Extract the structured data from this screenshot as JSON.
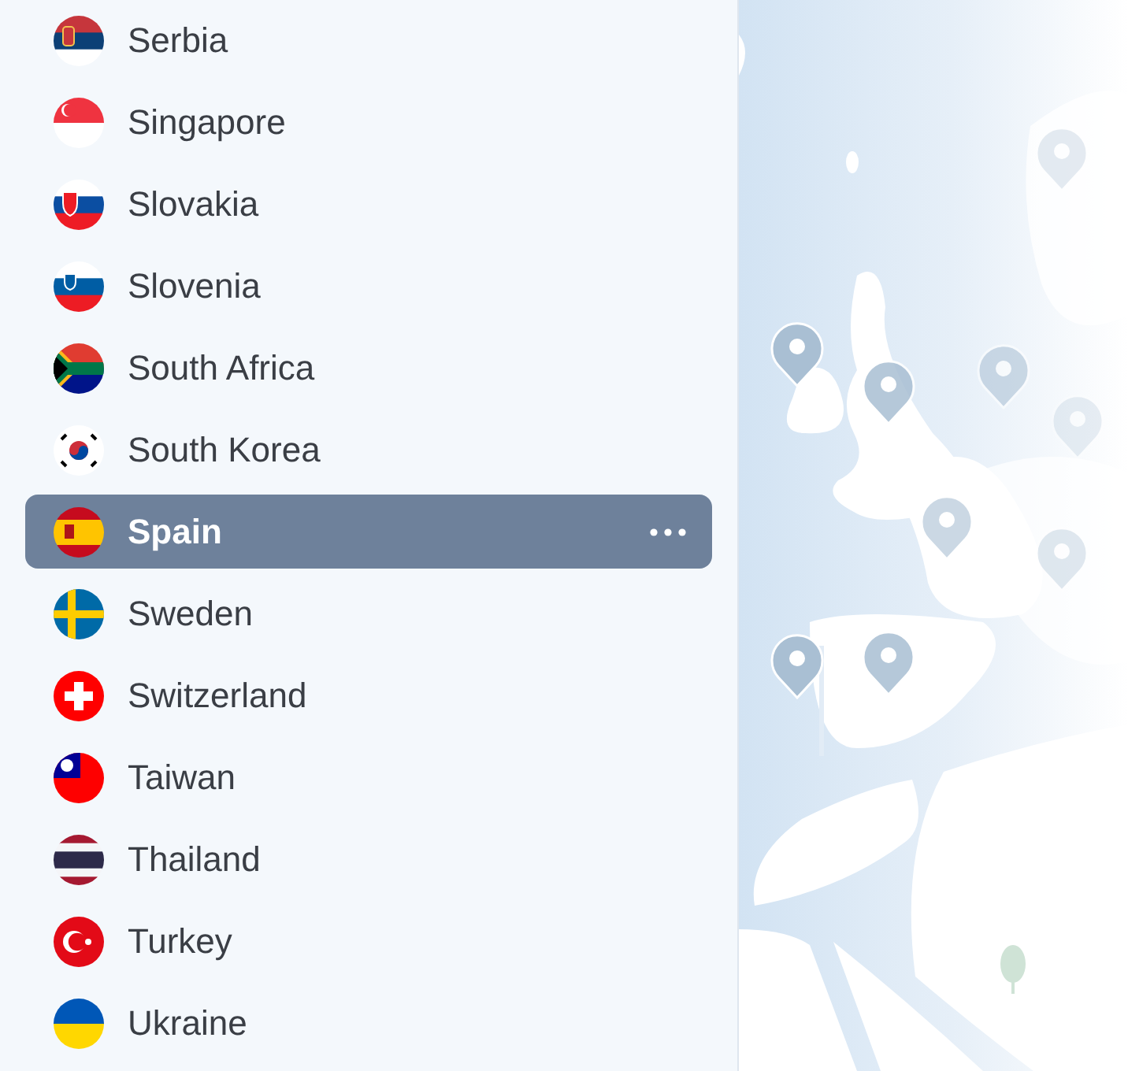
{
  "countries": [
    {
      "name": "Serbia",
      "selected": false
    },
    {
      "name": "Singapore",
      "selected": false
    },
    {
      "name": "Slovakia",
      "selected": false
    },
    {
      "name": "Slovenia",
      "selected": false
    },
    {
      "name": "South Africa",
      "selected": false
    },
    {
      "name": "South Korea",
      "selected": false
    },
    {
      "name": "Spain",
      "selected": true
    },
    {
      "name": "Sweden",
      "selected": false
    },
    {
      "name": "Switzerland",
      "selected": false
    },
    {
      "name": "Taiwan",
      "selected": false
    },
    {
      "name": "Thailand",
      "selected": false
    },
    {
      "name": "Turkey",
      "selected": false
    },
    {
      "name": "Ukraine",
      "selected": false
    }
  ]
}
